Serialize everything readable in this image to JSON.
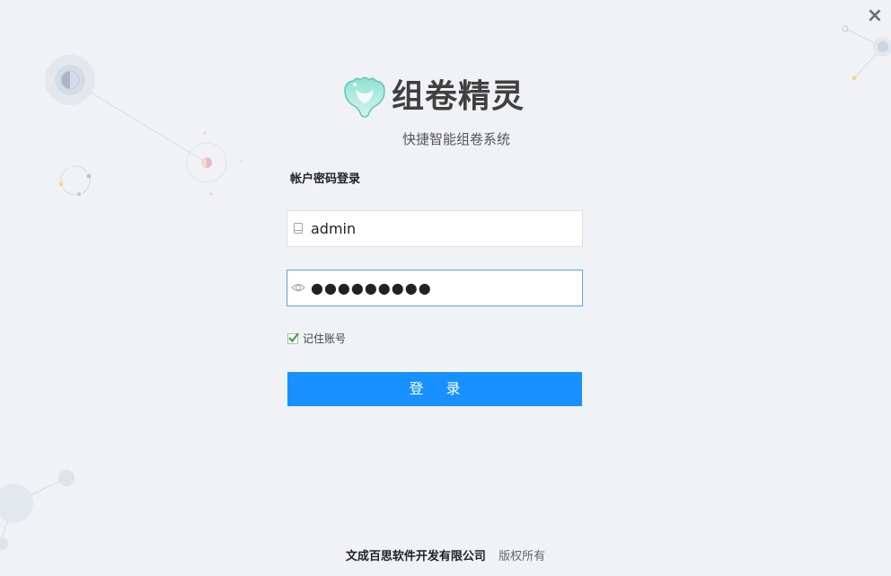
{
  "window": {
    "close_label": "×"
  },
  "branding": {
    "title": "组卷精灵",
    "subtitle": "快捷智能组卷系统",
    "logo_icon": "cloud-mascot-icon",
    "logo_color": "#7fd8c8"
  },
  "login": {
    "mode_label": "帐户密码登录",
    "username": {
      "value": "admin",
      "icon": "user-card-icon"
    },
    "password": {
      "value": "●●●●●●●●●",
      "icon": "eye-icon"
    },
    "remember": {
      "label": "记住账号",
      "checked": true
    },
    "submit_label": "登 录"
  },
  "footer": {
    "company": "文成百思软件开发有限公司",
    "rights": "版权所有"
  },
  "colors": {
    "background": "#f0f2f5",
    "primary": "#1890ff",
    "focus_border": "#57a6e8",
    "check": "#3a9a3a"
  }
}
